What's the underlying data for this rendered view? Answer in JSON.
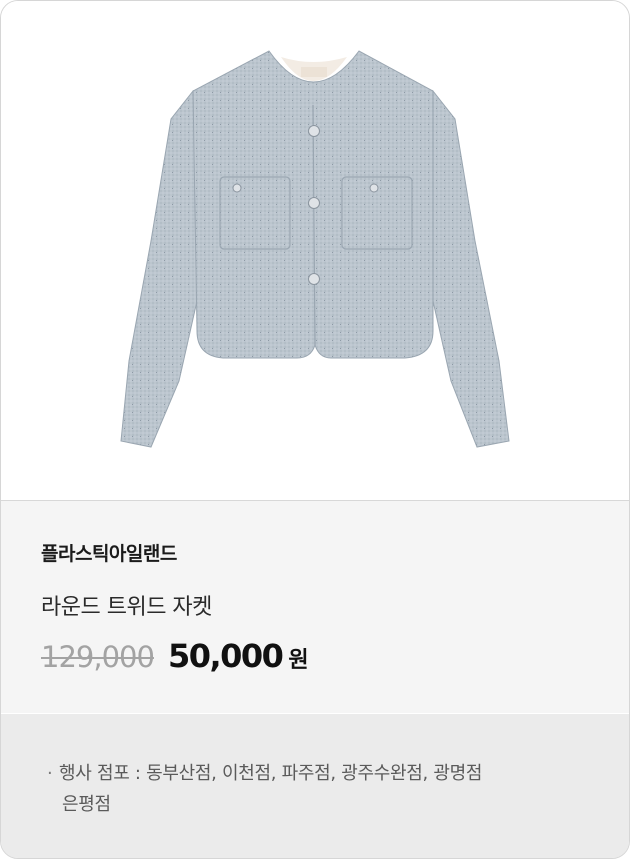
{
  "product": {
    "image_alt": "light blue-gray tweed round-neck cropped jacket",
    "colors": {
      "jacket": "#b9c3cd",
      "jacket_shadow": "#a3aeb9",
      "lining": "#f3ece4"
    },
    "brand": "플라스틱아일랜드",
    "name": "라운드 트위드 자켓",
    "original_price": "129,000",
    "sale_price": "50,000",
    "currency": "원"
  },
  "stores": {
    "bullet": "·",
    "label_line1": "행사 점포 : 동부산점, 이천점, 파주점, 광주수완점, 광명점",
    "label_line2": "은평점"
  }
}
